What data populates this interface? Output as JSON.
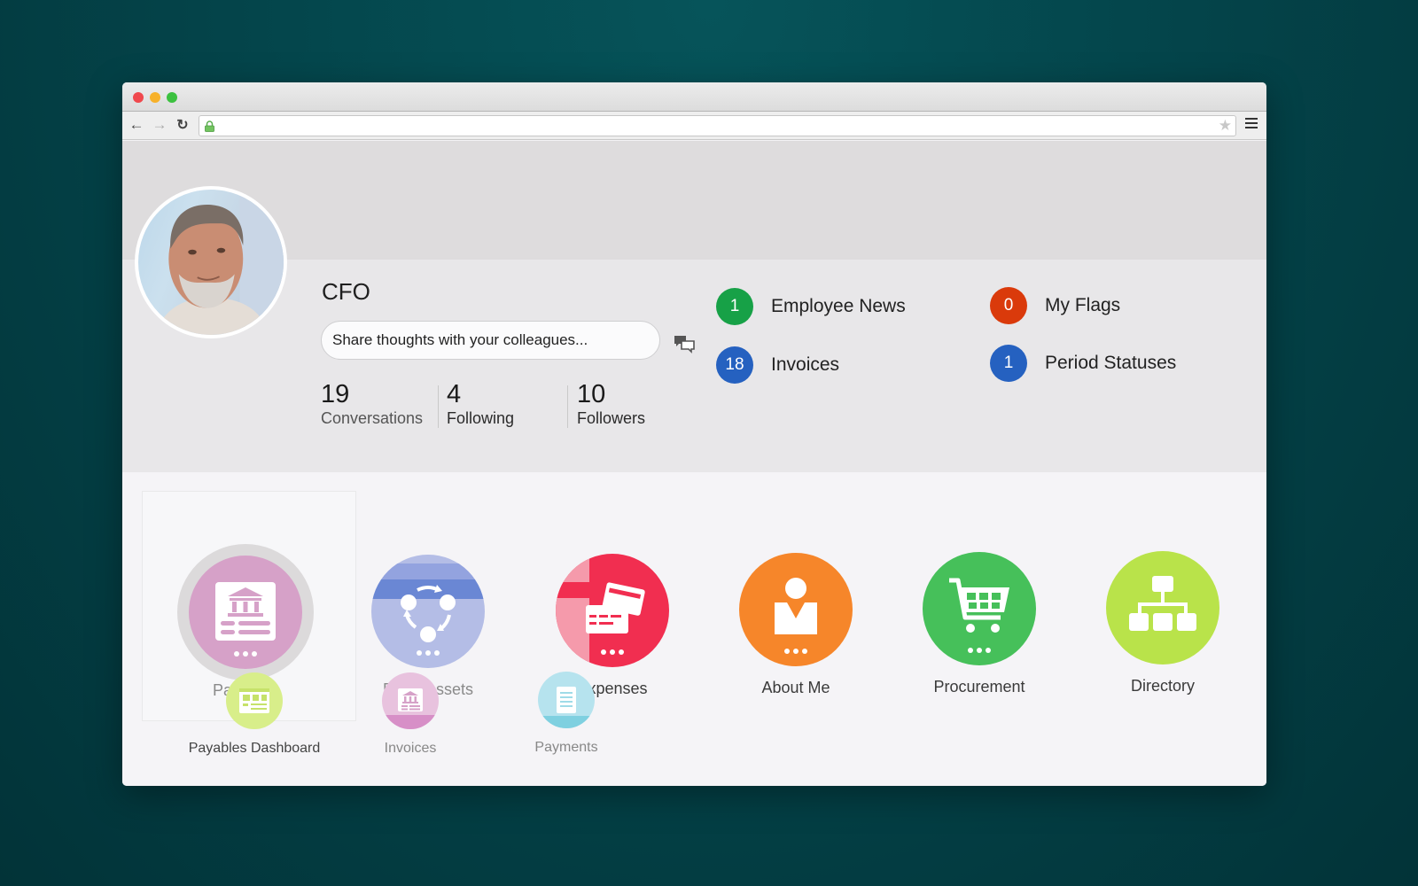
{
  "browser": {
    "url": "",
    "icons": {
      "back": "arrow-left-icon",
      "forward": "arrow-right-icon",
      "reload": "reload-icon",
      "secure": "lock-icon",
      "bookmark": "star-icon",
      "menu": "hamburger-menu-icon"
    }
  },
  "profile": {
    "role": "CFO",
    "share_placeholder": "Share thoughts with your colleagues...",
    "stats": [
      {
        "value": "19",
        "label": "Conversations"
      },
      {
        "value": "4",
        "label": "Following"
      },
      {
        "value": "10",
        "label": "Followers"
      }
    ]
  },
  "notifications": [
    {
      "count": "1",
      "label": "Employee News",
      "color": "#17a147"
    },
    {
      "count": "0",
      "label": "My Flags",
      "color": "#da3a0b"
    },
    {
      "count": "18",
      "label": "Invoices",
      "color": "#2561c0"
    },
    {
      "count": "1",
      "label": "Period Statuses",
      "color": "#2561c0"
    }
  ],
  "springboard": [
    {
      "label": "Payables",
      "icon": "bank-document-icon",
      "color": "#d6a1c8"
    },
    {
      "label": "Fixed Assets",
      "icon": "cycle-icon",
      "color": "#b4bde6"
    },
    {
      "label": "Expenses",
      "icon": "credit-cards-icon",
      "color": "#f12e50"
    },
    {
      "label": "About Me",
      "icon": "person-icon",
      "color": "#f6862a"
    },
    {
      "label": "Procurement",
      "icon": "shopping-cart-icon",
      "color": "#46c05a"
    },
    {
      "label": "Directory",
      "icon": "org-chart-icon",
      "color": "#b9e34a"
    }
  ],
  "sub_tiles": [
    {
      "label": "Payables Dashboard",
      "icon": "dashboard-icon",
      "color": "#d8ee8a"
    },
    {
      "label": "Invoices",
      "icon": "bank-document-icon",
      "color": "#e3b3d8"
    },
    {
      "label": "Payments",
      "icon": "document-icon",
      "color": "#9fdbe8"
    }
  ]
}
